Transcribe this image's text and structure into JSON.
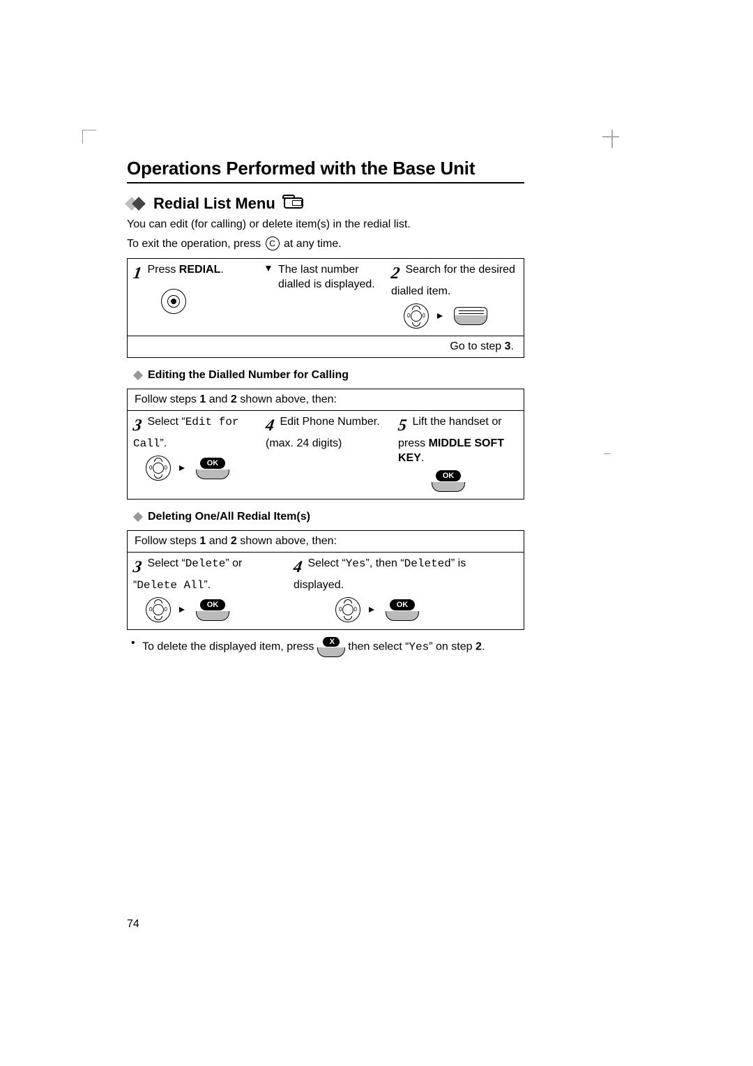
{
  "title": "Operations Performed with the Base Unit",
  "section": "Redial List Menu",
  "intro1": "You can edit (for calling) or delete item(s) in the redial list.",
  "intro2_pre": "To exit the operation, press ",
  "intro2_key": "C",
  "intro2_post": " at any time.",
  "panel1": {
    "step1_pre": "Press ",
    "step1_bold": "REDIAL",
    "step1_post": ".",
    "step1_note_pre": "The last number dialled is displayed.",
    "step2": "Search for the desired dialled item.",
    "goto_pre": "Go to step ",
    "goto_bold": "3",
    "goto_post": "."
  },
  "subA": "Editing the Dialled Number for Calling",
  "panelA": {
    "intro_pre": "Follow steps ",
    "intro_b1": "1",
    "intro_mid": " and ",
    "intro_b2": "2",
    "intro_post": " shown above, then:",
    "s3_pre": "Select “",
    "s3_mono": "Edit for Call",
    "s3_post": "”.",
    "s4_a": "Edit Phone Number.",
    "s4_b": "(max. 24 digits)",
    "s5_a": "Lift the handset or press ",
    "s5_bold": "MIDDLE SOFT KEY",
    "s5_post": "."
  },
  "subB": "Deleting One/All Redial Item(s)",
  "panelB": {
    "intro_pre": "Follow steps ",
    "intro_b1": "1",
    "intro_mid": " and ",
    "intro_b2": "2",
    "intro_post": " shown above, then:",
    "s3_pre": "Select “",
    "s3_m1": "Delete",
    "s3_mid": "” or “",
    "s3_m2": "Delete All",
    "s3_post": "”.",
    "s4_pre": "Select “",
    "s4_m1": "Yes",
    "s4_mid": "”, then “",
    "s4_m2": "Deleted",
    "s4_post": "” is displayed."
  },
  "foot": {
    "pre": "To delete the displayed item, press ",
    "mid": " then select “",
    "mono": "Yes",
    "post": "” on step ",
    "bold": "2",
    "end": "."
  },
  "ok": "OK",
  "x": "X",
  "page": "74",
  "nums": {
    "1": "1",
    "2": "2",
    "3": "3",
    "4": "4",
    "5": "5"
  }
}
